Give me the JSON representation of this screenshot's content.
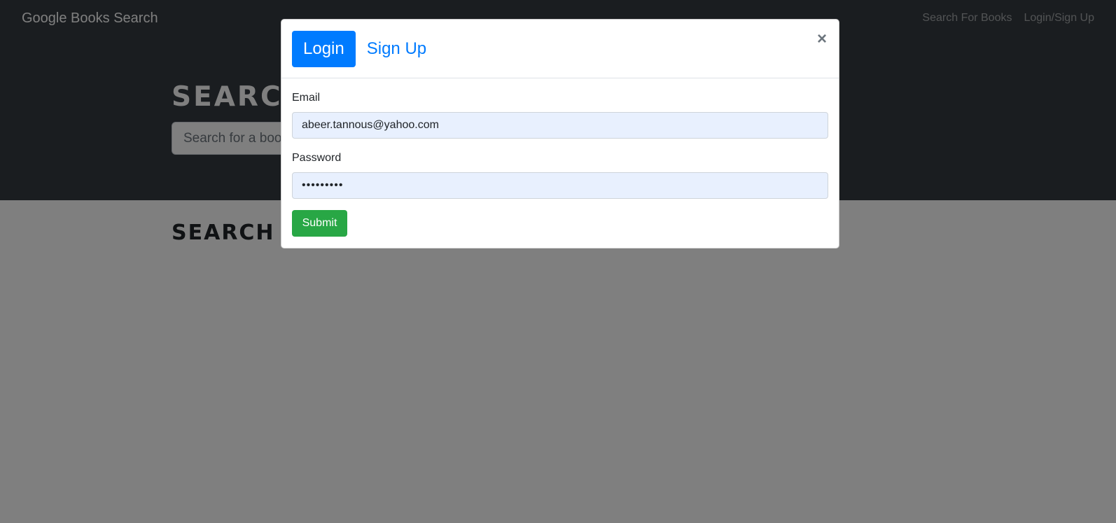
{
  "navbar": {
    "brand": "Google Books Search",
    "links": [
      "Search For Books",
      "Login/Sign Up"
    ]
  },
  "hero": {
    "title": "SEARCH FOR BOOKS!",
    "search_placeholder": "Search for a book"
  },
  "results": {
    "heading": "SEARCH FOR A BOOK TO BEGIN"
  },
  "modal": {
    "tabs": [
      "Login",
      "Sign Up"
    ],
    "active_tab": "Login",
    "close_glyph": "×",
    "email_label": "Email",
    "email_value": "abeer.tannous@yahoo.com",
    "password_label": "Password",
    "password_value": "•••••••••",
    "submit_label": "Submit"
  },
  "colors": {
    "navbar_bg": "#343a40",
    "primary": "#007bff",
    "success": "#28a745",
    "autofill_bg": "#e8f0fe"
  }
}
